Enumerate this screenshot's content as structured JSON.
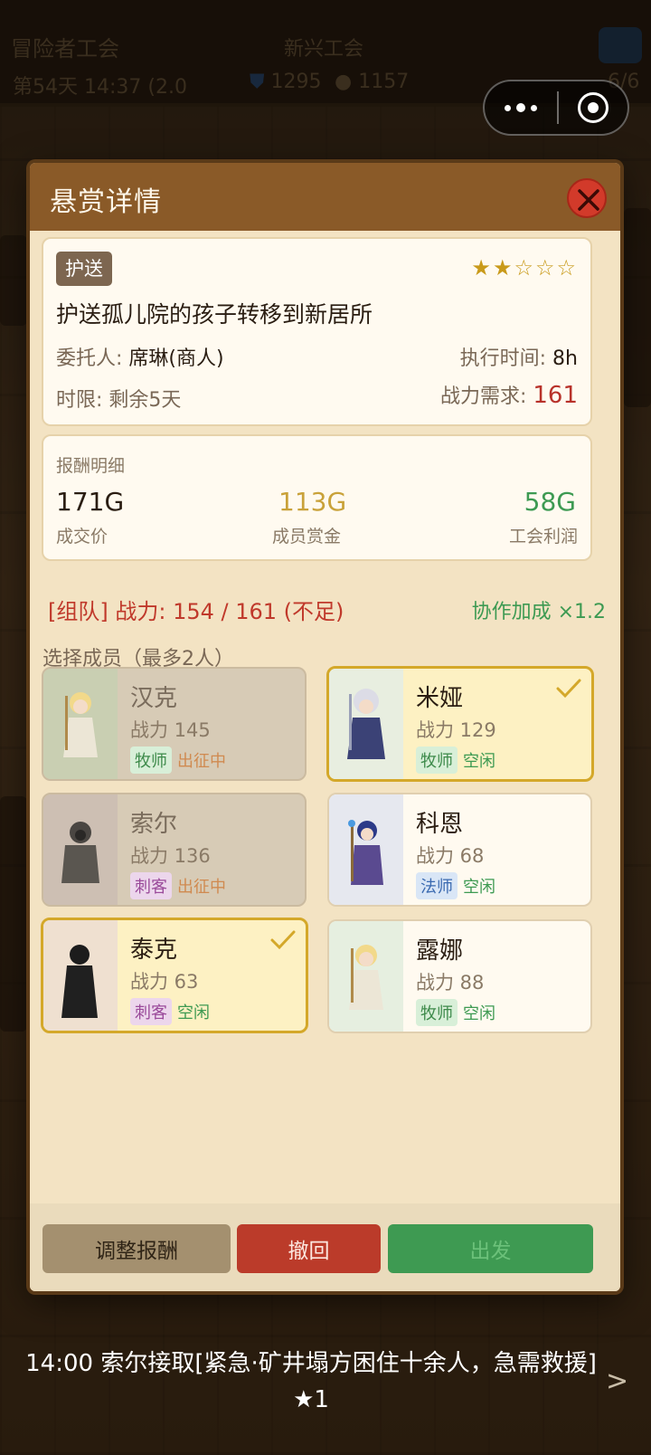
{
  "background": {
    "guild_name": "冒险者工会",
    "guild_rank": "新兴工会",
    "day_time": "第54天 14:37 (2.0",
    "shield_value": "1295",
    "gold_value": "1157",
    "party_count": "6/6"
  },
  "modal": {
    "title": "悬赏详情",
    "close_icon": "close-icon"
  },
  "quest": {
    "type": "护送",
    "stars_filled": 2,
    "stars_total": 5,
    "stars_text_on": "★★",
    "stars_text_off": "☆☆☆",
    "title": "护送孤儿院的孩子转移到新居所",
    "client_label": "委托人: ",
    "client_value": "席琳(商人)",
    "exec_label": "执行时间: ",
    "exec_value": "8h",
    "deadline_label": "时限: ",
    "deadline_value": "剩余5天",
    "power_req_label": "战力需求: ",
    "power_req_value": "161"
  },
  "rewards": {
    "heading": "报酬明细",
    "deal_price": "171G",
    "deal_price_label": "成交价",
    "member_bounty": "113G",
    "member_bounty_label": "成员赏金",
    "guild_profit": "58G",
    "guild_profit_label": "工会利润"
  },
  "team": {
    "summary": "[组队] 战力: 154 / 161 (不足)",
    "coop_bonus": "协作加成 ×1.2",
    "select_label": "选择成员（最多2人）"
  },
  "members": [
    {
      "name": "汉克",
      "power": "战力 145",
      "class": "牧师",
      "status": "出征中",
      "state": "busy"
    },
    {
      "name": "米娅",
      "power": "战力 129",
      "class": "牧师",
      "status": "空闲",
      "state": "selected"
    },
    {
      "name": "索尔",
      "power": "战力 136",
      "class": "刺客",
      "status": "出征中",
      "state": "busy"
    },
    {
      "name": "科恩",
      "power": "战力 68",
      "class": "法师",
      "status": "空闲",
      "state": "idle"
    },
    {
      "name": "泰克",
      "power": "战力 63",
      "class": "刺客",
      "status": "空闲",
      "state": "selected"
    },
    {
      "name": "露娜",
      "power": "战力 88",
      "class": "牧师",
      "status": "空闲",
      "state": "idle"
    }
  ],
  "footer": {
    "adjust_label": "调整报酬",
    "withdraw_label": "撤回",
    "go_label": "出发"
  },
  "ticker": {
    "text": "14:00 索尔接取[紧急·矿井塌方困住十余人，急需救援] ★1",
    "arrow": ">"
  },
  "colors": {
    "header_brown": "#8a5a28",
    "danger_red": "#bb3b2a",
    "go_green": "#3e9a52",
    "gold": "#d4a82a",
    "power_red": "#b8322a"
  }
}
